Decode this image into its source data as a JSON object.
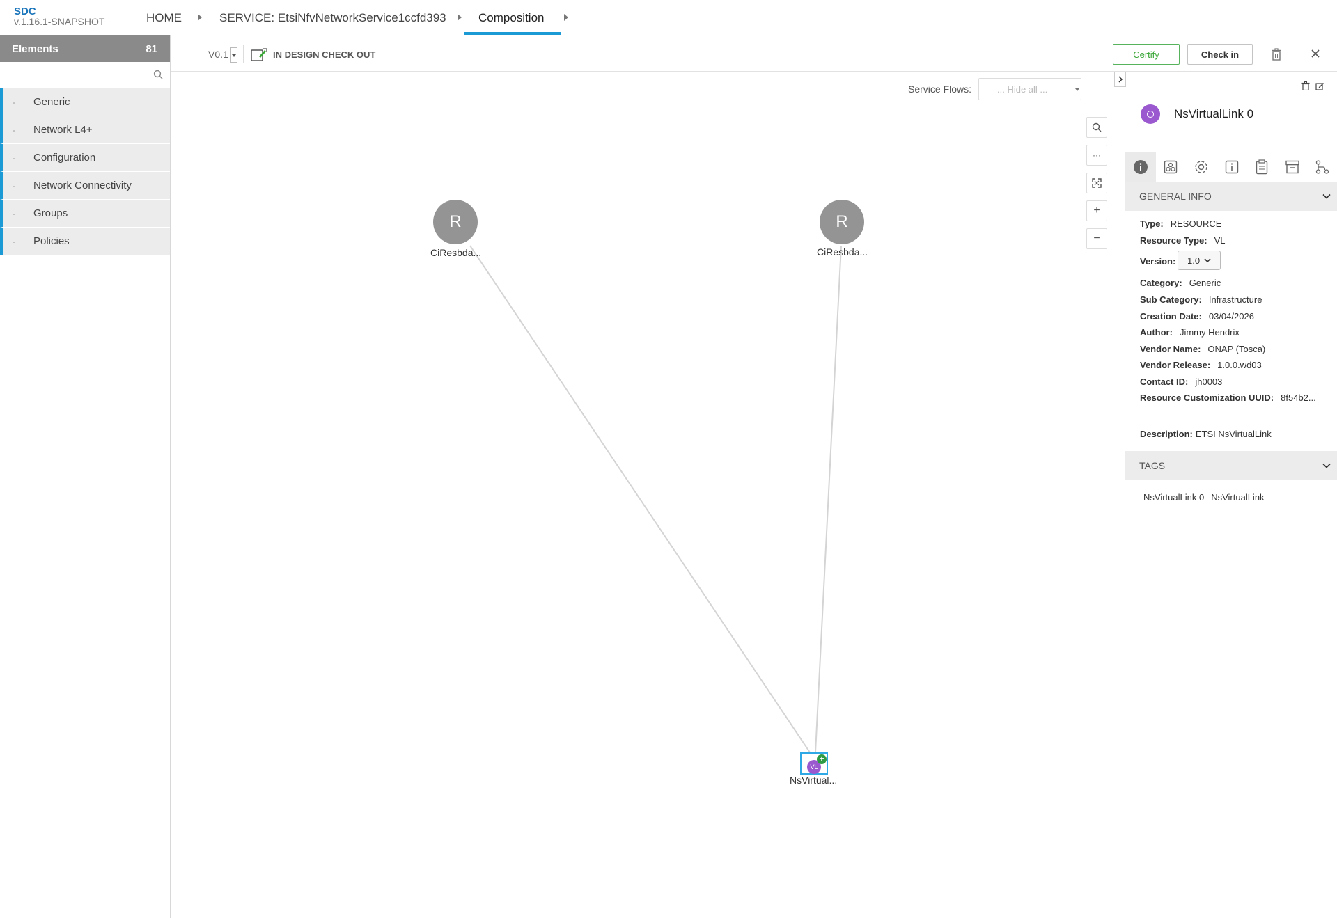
{
  "app": {
    "name": "SDC",
    "version": "v.1.16.1-SNAPSHOT"
  },
  "breadcrumbs": [
    {
      "label": "HOME"
    },
    {
      "label": "SERVICE: EtsiNfvNetworkService1ccfd393"
    },
    {
      "label": "Composition"
    }
  ],
  "left_panel": {
    "title": "Elements",
    "count": "81",
    "search_placeholder": "",
    "categories": [
      "Generic",
      "Network L4+",
      "Configuration",
      "Network Connectivity",
      "Groups",
      "Policies"
    ]
  },
  "toolbar": {
    "version": "V0.1",
    "status": "IN DESIGN CHECK OUT",
    "certify_label": "Certify",
    "checkin_label": "Check in"
  },
  "canvas": {
    "service_flows_label": "Service Flows:",
    "service_flows_value": "... Hide all ...",
    "nodes": [
      {
        "letter": "R",
        "label": "CiResbda..."
      },
      {
        "letter": "R",
        "label": "CiResbda..."
      },
      {
        "letter": "VL",
        "label": "NsVirtual..."
      }
    ]
  },
  "right_panel": {
    "title": "NsVirtualLink 0",
    "general_info_title": "GENERAL INFO",
    "fields": {
      "type_label": "Type:",
      "type": "RESOURCE",
      "resource_type_label": "Resource Type:",
      "resource_type": "VL",
      "version_label": "Version:",
      "version": "1.0",
      "category_label": "Category:",
      "category": "Generic",
      "sub_category_label": "Sub Category:",
      "sub_category": "Infrastructure",
      "creation_date_label": "Creation Date:",
      "creation_date": "03/04/2026",
      "author_label": "Author:",
      "author": "Jimmy Hendrix",
      "vendor_name_label": "Vendor Name:",
      "vendor_name": "ONAP (Tosca)",
      "vendor_release_label": "Vendor Release:",
      "vendor_release": "1.0.0.wd03",
      "contact_id_label": "Contact ID:",
      "contact_id": "jh0003",
      "uuid_label": "Resource Customization UUID:",
      "uuid": "8f54b2...",
      "description_label": "Description:",
      "description": "ETSI NsVirtualLink"
    },
    "tags_title": "TAGS",
    "tags": [
      "NsVirtualLink 0",
      "NsVirtualLink"
    ]
  },
  "colors": {
    "accent": "#1b9ad6",
    "certify": "#3aa637",
    "node": "#949494",
    "vl": "#9b59d0"
  }
}
